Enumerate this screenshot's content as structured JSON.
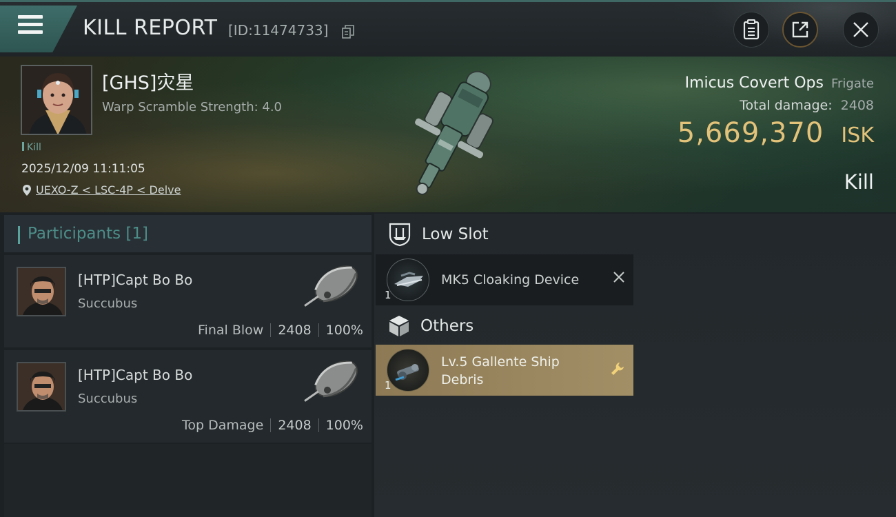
{
  "header": {
    "title": "KILL REPORT",
    "report_id": "[ID:11474733]"
  },
  "victim": {
    "pilot_name": "[GHS]灾星",
    "warp_scramble": "Warp Scramble Strength: 4.0",
    "kill_tag": "Kill",
    "datetime": "2025/12/09 11:11:05",
    "location": "UEXO-Z < LSC-4P < Delve",
    "ship_name": "Imicus Covert Ops",
    "ship_class": "Frigate",
    "total_damage_label": "Total damage:",
    "total_damage_value": "2408",
    "isk_value": "5,669,370",
    "isk_unit": "ISK",
    "result_label": "Kill"
  },
  "participants": {
    "header": "Participants [1]",
    "rows": [
      {
        "name": "[HTP]Capt Bo Bo",
        "ship": "Succubus",
        "role": "Final Blow",
        "damage": "2408",
        "percent": "100%"
      },
      {
        "name": "[HTP]Capt Bo Bo",
        "ship": "Succubus",
        "role": "Top Damage",
        "damage": "2408",
        "percent": "100%"
      }
    ]
  },
  "fitting": {
    "low_slot": {
      "title": "Low Slot",
      "items": [
        {
          "qty": "1",
          "name": "MK5 Cloaking Device"
        }
      ]
    },
    "others": {
      "title": "Others",
      "items": [
        {
          "qty": "1",
          "name_line1": "Lv.5 Gallente Ship",
          "name_line2": "Debris"
        }
      ]
    }
  },
  "colors": {
    "accent_teal": "#3e6d69",
    "isk_gold": "#e3c27a",
    "highlight_gold": "#a38f66"
  },
  "icons": [
    "menu-icon",
    "copy-icon",
    "clipboard-icon",
    "share-icon",
    "close-icon",
    "location-pin-icon",
    "shield-slot-icon",
    "cube-icon",
    "x-icon",
    "wrench-icon"
  ]
}
